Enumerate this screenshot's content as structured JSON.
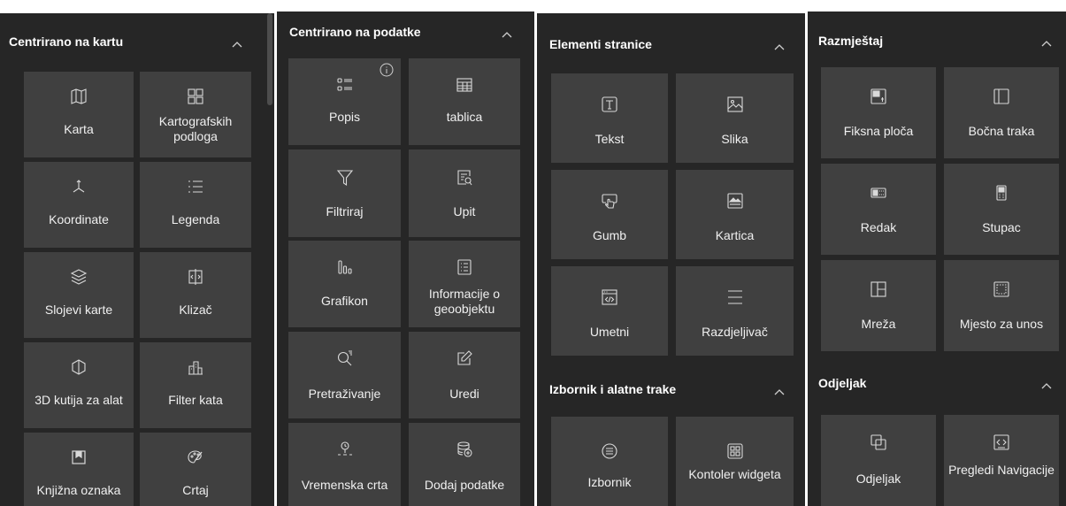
{
  "panel_map": {
    "title": "Centrirano na kartu",
    "items": [
      {
        "label": "Karta",
        "icon": "map-icon"
      },
      {
        "label": "Kartografskih podloga",
        "icon": "basemap-gallery-icon"
      },
      {
        "label": "Koordinate",
        "icon": "coordinates-icon"
      },
      {
        "label": "Legenda",
        "icon": "legend-icon"
      },
      {
        "label": "Slojevi karte",
        "icon": "layers-icon"
      },
      {
        "label": "Klizač",
        "icon": "swipe-icon"
      },
      {
        "label": "3D kutija za alat",
        "icon": "3d-toolbox-icon"
      },
      {
        "label": "Filter kata",
        "icon": "floor-filter-icon"
      },
      {
        "label": "Knjižna oznaka",
        "icon": "bookmark-icon"
      },
      {
        "label": "Crtaj",
        "icon": "draw-icon"
      }
    ]
  },
  "panel_data": {
    "title": "Centrirano na podatke",
    "items": [
      {
        "label": "Popis",
        "icon": "list-icon"
      },
      {
        "label": "tablica",
        "icon": "table-icon"
      },
      {
        "label": "Filtriraj",
        "icon": "filter-icon"
      },
      {
        "label": "Upit",
        "icon": "query-icon"
      },
      {
        "label": "Grafikon",
        "icon": "chart-icon"
      },
      {
        "label": "Informacije o geoobjektu",
        "icon": "feature-info-icon"
      },
      {
        "label": "Pretraživanje",
        "icon": "search-icon"
      },
      {
        "label": "Uredi",
        "icon": "edit-icon"
      },
      {
        "label": "Vremenska crta",
        "icon": "timeline-icon"
      },
      {
        "label": "Dodaj podatke",
        "icon": "add-data-icon"
      }
    ]
  },
  "panel_page": {
    "title": "Elementi stranice",
    "items": [
      {
        "label": "Tekst",
        "icon": "text-icon"
      },
      {
        "label": "Slika",
        "icon": "image-icon"
      },
      {
        "label": "Gumb",
        "icon": "button-icon"
      },
      {
        "label": "Kartica",
        "icon": "card-icon"
      },
      {
        "label": "Umetni",
        "icon": "embed-icon"
      },
      {
        "label": "Razdjeljivač",
        "icon": "divider-icon"
      }
    ],
    "menu_title": "Izbornik i alatne trake",
    "menu_items": [
      {
        "label": "Izbornik",
        "icon": "menu-icon"
      },
      {
        "label": "Kontoler widgeta",
        "icon": "widget-controller-icon"
      }
    ]
  },
  "panel_layout": {
    "title": "Razmještaj",
    "items": [
      {
        "label": "Fiksna ploča",
        "icon": "fixed-panel-icon"
      },
      {
        "label": "Bočna traka",
        "icon": "sidebar-icon"
      },
      {
        "label": "Redak",
        "icon": "row-icon"
      },
      {
        "label": "Stupac",
        "icon": "column-icon"
      },
      {
        "label": "Mreža",
        "icon": "grid-icon"
      },
      {
        "label": "Mjesto za unos",
        "icon": "placeholder-icon"
      }
    ],
    "section_title": "Odjeljak",
    "section_items": [
      {
        "label": "Odjeljak",
        "icon": "section-icon"
      },
      {
        "label": "Pregledi Navigacije",
        "icon": "views-navigation-icon"
      }
    ]
  },
  "colors": {
    "panel_bg": "#262626",
    "tile_bg": "#404040",
    "text": "#ffffff",
    "icon": "#d9d9d9"
  }
}
